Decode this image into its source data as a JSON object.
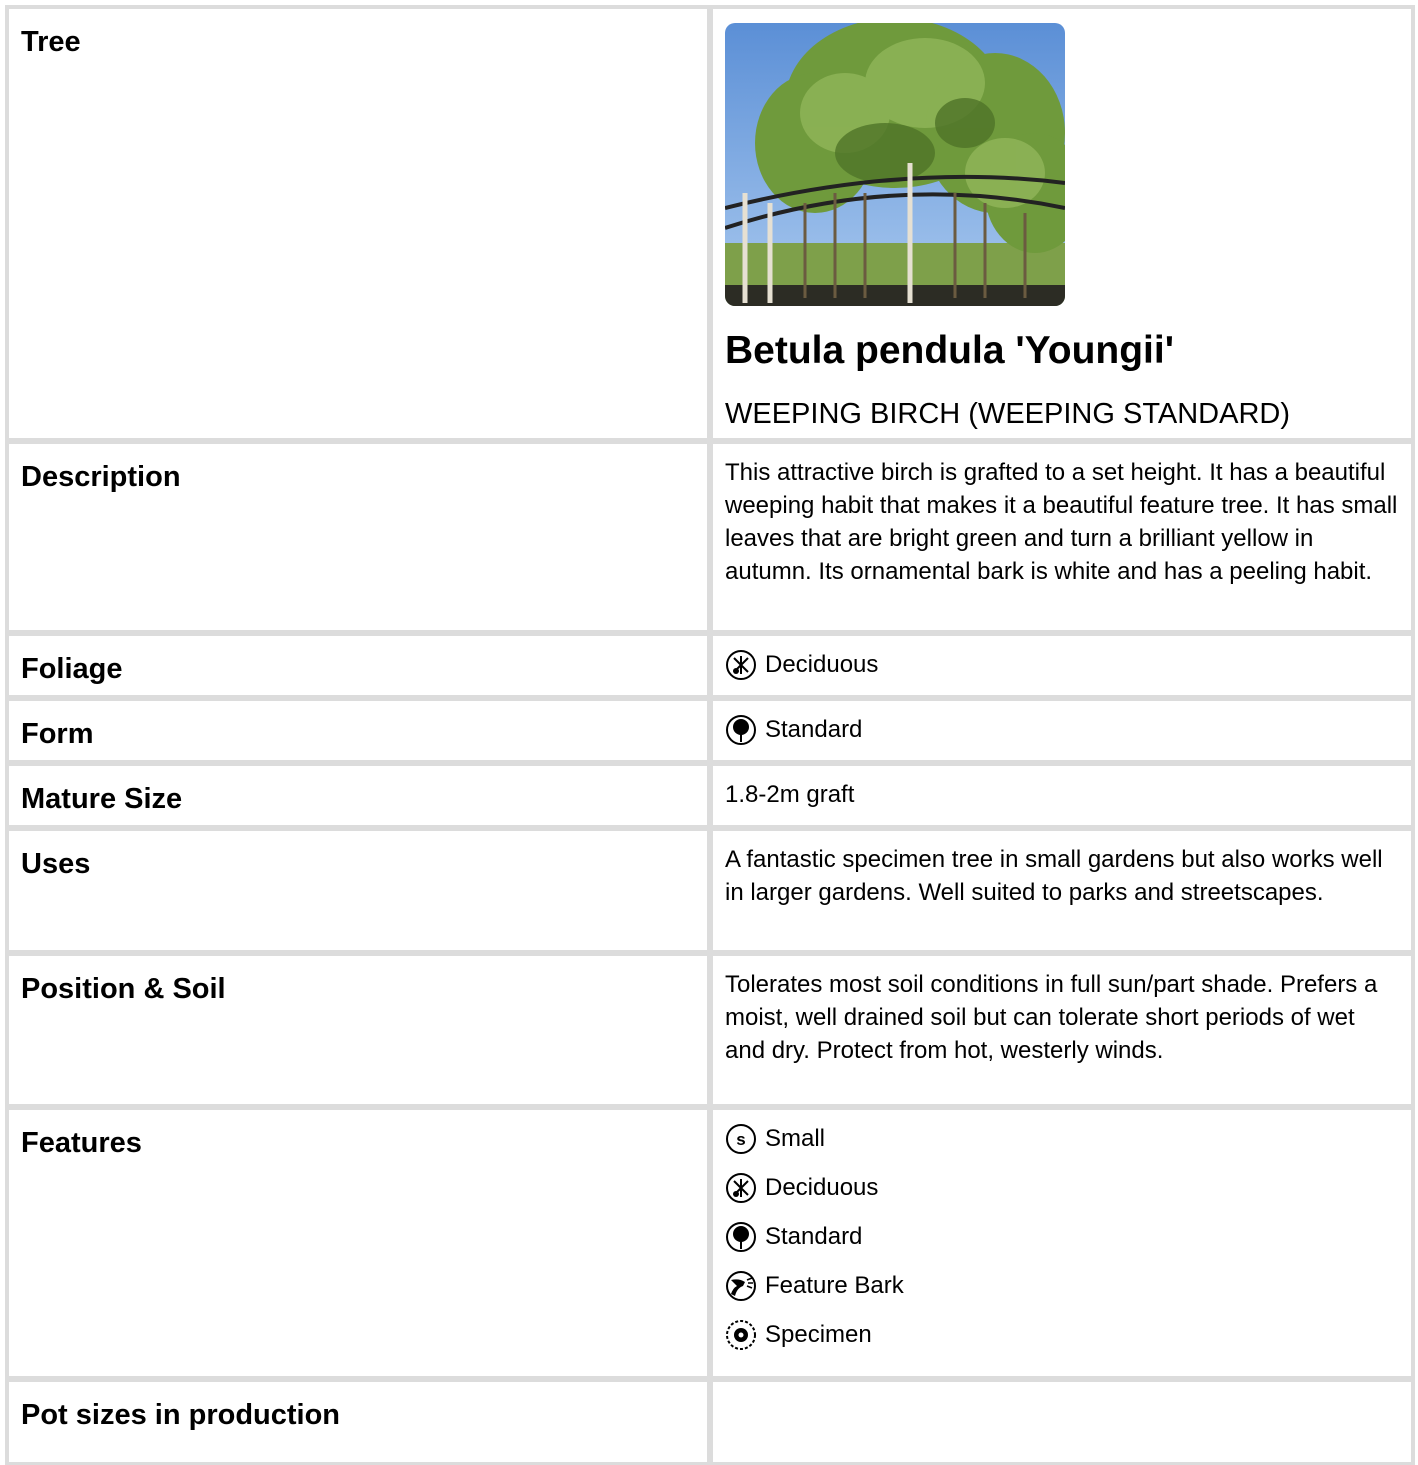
{
  "tree": {
    "label": "Tree",
    "scientific_name": "Betula pendula 'Youngii'",
    "common_name": "WEEPING BIRCH (WEEPING STANDARD)"
  },
  "description": {
    "label": "Description",
    "text": "This attractive birch is grafted to a set height. It has a beautiful weeping habit that makes it a beautiful feature tree. It has small leaves that are bright green and turn a brilliant yellow in autumn. Its ornamental bark is white and has a peeling habit."
  },
  "foliage": {
    "label": "Foliage",
    "value": "Deciduous",
    "icon": "deciduous-icon"
  },
  "form": {
    "label": "Form",
    "value": "Standard",
    "icon": "standard-icon"
  },
  "mature_size": {
    "label": "Mature Size",
    "value": "1.8-2m graft"
  },
  "uses": {
    "label": "Uses",
    "text": "A fantastic specimen tree in small gardens but also works well in larger gardens. Well suited to parks and streetscapes."
  },
  "position_soil": {
    "label": "Position & Soil",
    "text": "Tolerates most soil conditions in full sun/part shade. Prefers a moist, well drained soil but can tolerate short periods of wet and dry. Protect from hot, westerly winds."
  },
  "features": {
    "label": "Features",
    "items": [
      {
        "label": "Small",
        "icon": "small-size-icon"
      },
      {
        "label": "Deciduous",
        "icon": "deciduous-icon"
      },
      {
        "label": "Standard",
        "icon": "standard-icon"
      },
      {
        "label": "Feature Bark",
        "icon": "feature-bark-icon"
      },
      {
        "label": "Specimen",
        "icon": "specimen-icon"
      }
    ]
  },
  "pot_sizes": {
    "label": "Pot sizes in production"
  }
}
